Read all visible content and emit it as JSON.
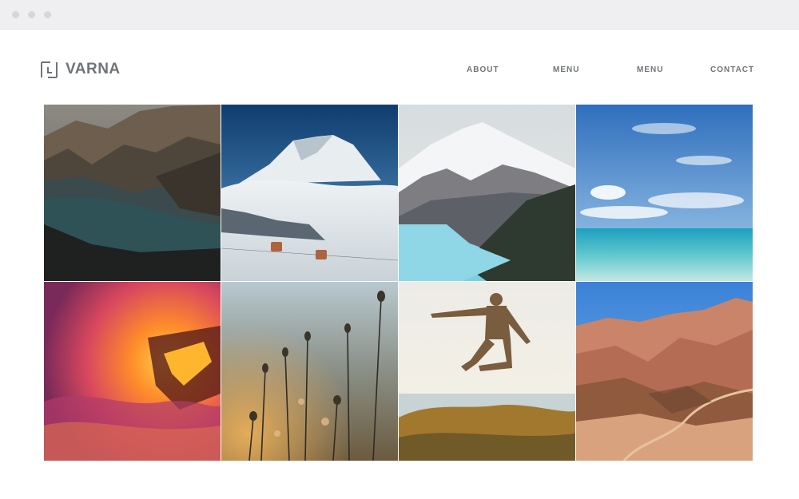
{
  "brand": {
    "name": "VARNA"
  },
  "nav": {
    "items": [
      "ABOUT",
      "MENU",
      "MENU",
      "CONTACT"
    ]
  },
  "gallery": {
    "photos": [
      "mountain-lake-photo",
      "snowy-peak-clouds-photo",
      "glacier-lake-photo",
      "tropical-beach-photo",
      "lava-ocean-photo",
      "wildflowers-sunset-photo",
      "jumping-man-photo",
      "desert-hills-photo"
    ]
  },
  "colors": {
    "text": "#6f7479",
    "background": "#ffffff",
    "chrome": "#efeff1"
  }
}
